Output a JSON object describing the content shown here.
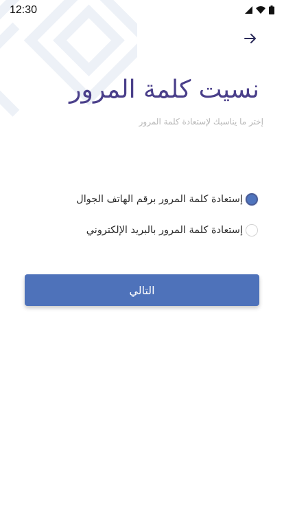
{
  "status_bar": {
    "time": "12:30",
    "icons": [
      "signal-icon",
      "wifi-icon",
      "battery-icon"
    ]
  },
  "header": {
    "back_icon": "arrow-right-icon"
  },
  "title": "نسيت كلمة المرور",
  "subtitle": "إختر ما يناسبك لإستعادة كلمة المرور",
  "options": [
    {
      "label": "إستعادة كلمة المرور برقم الهاتف الجوال",
      "selected": true
    },
    {
      "label": "إستعادة كلمة المرور بالبريد الإلكتروني",
      "selected": false
    }
  ],
  "next_button": {
    "label": "التالي"
  },
  "colors": {
    "title": "#4a3f8a",
    "accent": "#4e72ba",
    "subtitle": "#b6b6b6",
    "pattern": "#eef1f7"
  }
}
